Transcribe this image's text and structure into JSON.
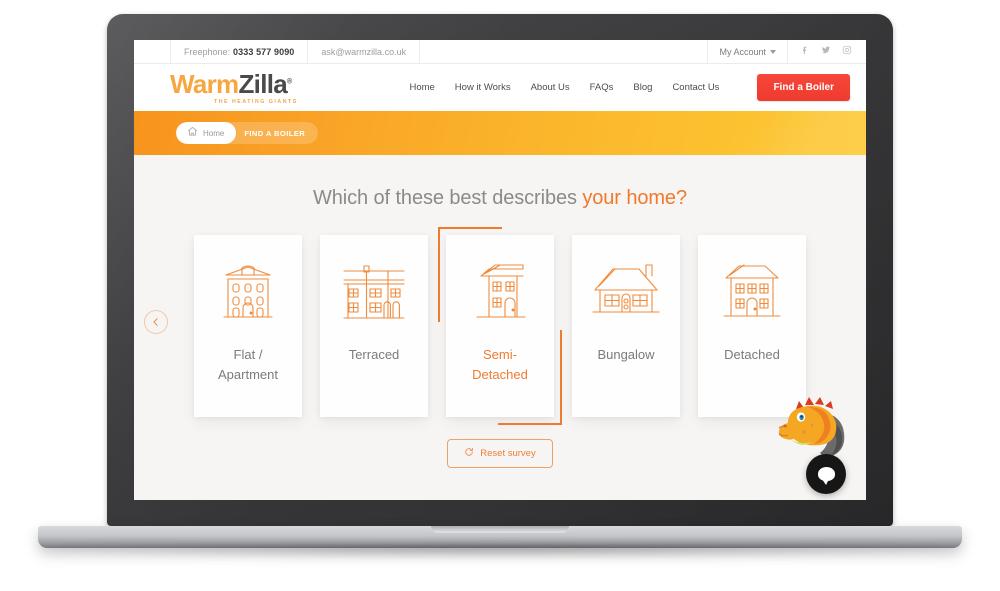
{
  "utility_bar": {
    "phone_label": "Freephone:",
    "phone_number": "0333 577 9090",
    "email": "ask@warmzilla.co.uk",
    "account_label": "My Account",
    "social": [
      "facebook-icon",
      "twitter-icon",
      "instagram-icon"
    ]
  },
  "logo": {
    "part1": "Warm",
    "part2": "Zilla",
    "registered": "®",
    "tagline": "THE HEATING GIANTS"
  },
  "nav": {
    "links": [
      {
        "label": "Home"
      },
      {
        "label": "How it Works"
      },
      {
        "label": "About Us"
      },
      {
        "label": "FAQs"
      },
      {
        "label": "Blog"
      },
      {
        "label": "Contact Us"
      }
    ],
    "cta_label": "Find a Boiler",
    "cta_color": "#ef3b2d"
  },
  "breadcrumb": {
    "home_label": "Home",
    "home_icon": "home-icon",
    "current_label": "FIND A BOILER"
  },
  "survey": {
    "heading_plain": "Which of these best describes ",
    "heading_highlight": "your home?",
    "accent_color": "#ef7b2e",
    "back_label": "‹",
    "options": [
      {
        "label": "Flat /\nApartment",
        "icon": "flat-apartment-icon",
        "selected": false
      },
      {
        "label": "Terraced",
        "icon": "terraced-house-icon",
        "selected": false
      },
      {
        "label": "Semi-\nDetached",
        "icon": "semi-detached-house-icon",
        "selected": true
      },
      {
        "label": "Bungalow",
        "icon": "bungalow-icon",
        "selected": false
      },
      {
        "label": "Detached",
        "icon": "detached-house-icon",
        "selected": false
      }
    ],
    "reset_label": "Reset survey",
    "reset_icon": "refresh-icon"
  },
  "chat": {
    "mascot": "dinosaur-mascot",
    "button_icon": "chat-bubble-icon"
  }
}
